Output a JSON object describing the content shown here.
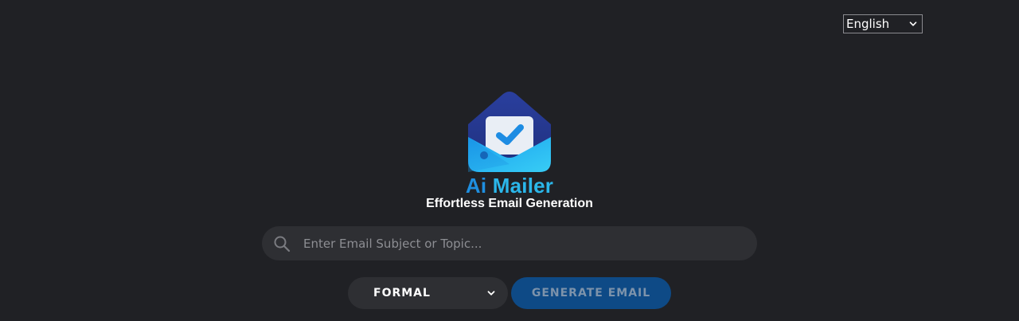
{
  "language_selector": {
    "selected": "English"
  },
  "brand": {
    "name_part1": "Ai",
    "name_part2": "Mailer",
    "tagline": "Effortless Email Generation",
    "logo_icon": "envelope-check-icon",
    "colors": {
      "ai": "#1f8fe0",
      "mailer": "#2bb7ea",
      "envelope_dark": "#243a8f",
      "envelope_light": "#22b7f0"
    }
  },
  "search": {
    "placeholder": "Enter Email Subject or Topic...",
    "value": "",
    "icon": "search-icon"
  },
  "tone": {
    "selected": "FORMAL"
  },
  "generate_button": {
    "label": "GENERATE EMAIL",
    "color": "#0e4a86"
  },
  "theme": {
    "background": "#202125",
    "surface": "#2e2f33"
  }
}
